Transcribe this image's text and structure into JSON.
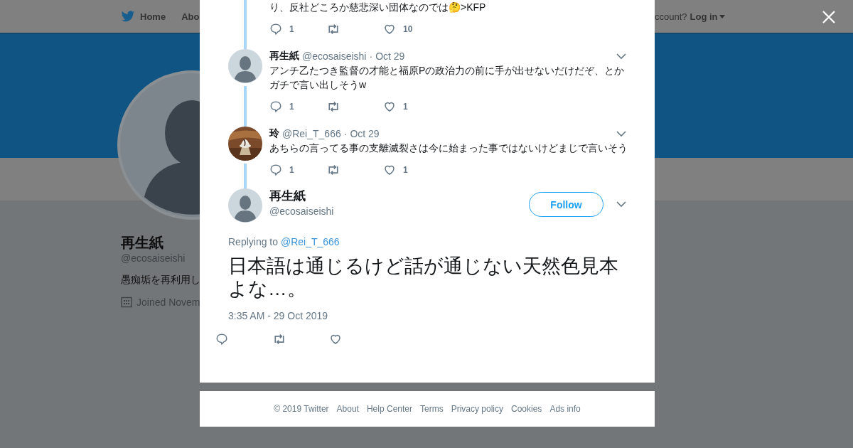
{
  "nav": {
    "items": [
      {
        "label": "Home",
        "kind": "home"
      },
      {
        "label": "Abo",
        "kind": "plain"
      }
    ],
    "account_prompt": "ccount?",
    "login": "Log in"
  },
  "profile": {
    "name": "再生紙",
    "handle": "@ecosaiseishi",
    "bio": "愚痴垢を再利用し",
    "joined": "Joined Novem"
  },
  "thread": [
    {
      "text": "り、反社どころか慈悲深い団体なのでは🤔>KFP",
      "replies": "1",
      "likes": "10"
    },
    {
      "name": "再生紙",
      "handle": "@ecosaiseishi",
      "separator": "·",
      "date": "Oct 29",
      "kind": "silhouette",
      "text": "アンチ乙たつき監督の才能と福原Pの政治力の前に手が出せないだけだぞ、とかガチで言い出しそうw",
      "replies": "1",
      "likes": "1"
    },
    {
      "name": "玲",
      "handle": "@Rei_T_666",
      "separator": "·",
      "date": "Oct 29",
      "kind": "picture",
      "text": "あちらの言ってる事の支離滅裂さは今に始まった事ではないけどまじで言いそう",
      "replies": "1",
      "likes": "1"
    }
  ],
  "tweet": {
    "name": "再生紙",
    "handle": "@ecosaiseishi",
    "kind": "silhouette",
    "follow": "Follow",
    "replying_label": "Replying to",
    "replying_to": "@Rei_T_666",
    "text": "日本語は通じるけど話が通じない天然色見本よな…。",
    "time": "3:35 AM - 29 Oct 2019"
  },
  "footer": [
    "© 2019 Twitter",
    "About",
    "Help Center",
    "Terms",
    "Privacy policy",
    "Cookies",
    "Ads info"
  ]
}
